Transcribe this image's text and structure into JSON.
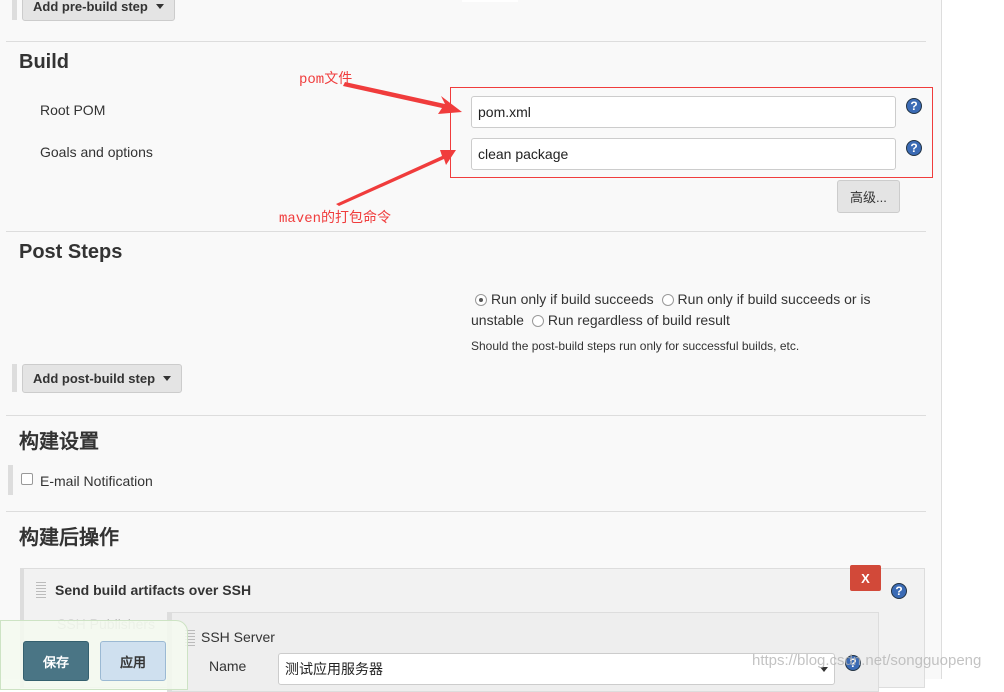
{
  "prebuild": {
    "add_label": "Add pre-build step"
  },
  "build": {
    "title": "Build",
    "root_pom_label": "Root POM",
    "root_pom_value": "pom.xml",
    "goals_label": "Goals and options",
    "goals_value": "clean package",
    "advanced_label": "高级..."
  },
  "annotations": {
    "pom": "pom文件",
    "maven": "maven的打包命令",
    "accent": "#f03c3c"
  },
  "post_steps": {
    "title": "Post Steps",
    "options": [
      "Run only if build succeeds",
      "Run only if build succeeds or is",
      "unstable",
      "Run regardless of build result"
    ],
    "selected": 0,
    "hint": "Should the post-build steps run only for successful builds, etc.",
    "add_label": "Add post-build step"
  },
  "build_settings": {
    "title": "构建设置",
    "email_label": "E-mail Notification",
    "email_checked": false
  },
  "post_build": {
    "title": "构建后操作",
    "ssh_title": "Send build artifacts over SSH",
    "delete_label": "X",
    "publishers_label": "SSH Publishers",
    "server_label": "SSH Server",
    "name_label": "Name",
    "name_value": "测试应用服务器"
  },
  "footer": {
    "save_label": "保存",
    "apply_label": "应用"
  },
  "watermark": "https://blog.csdn.net/songguopeng"
}
